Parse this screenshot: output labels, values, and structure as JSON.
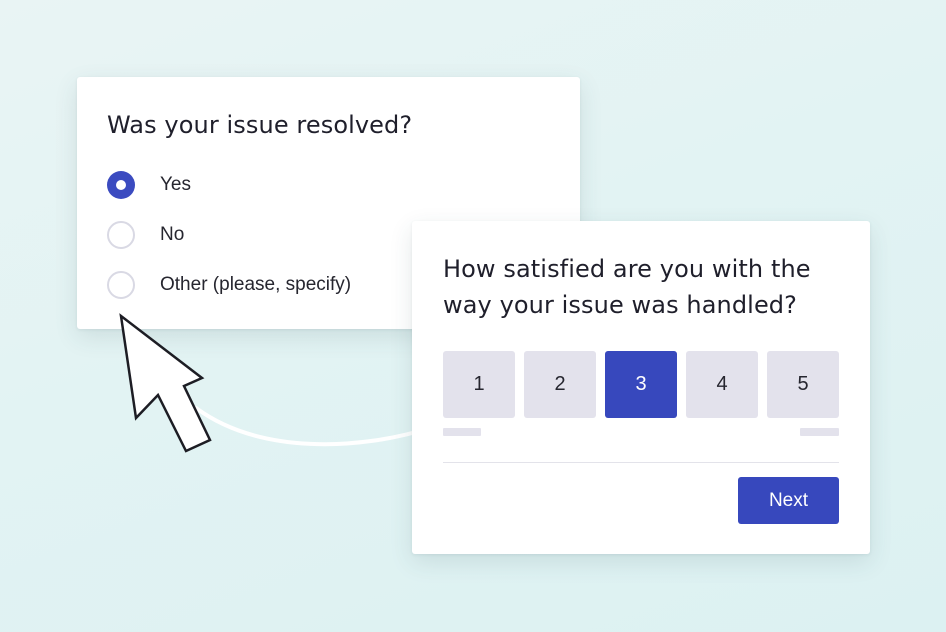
{
  "survey_resolved": {
    "question": "Was your issue resolved?",
    "options": [
      {
        "label": "Yes",
        "selected": true
      },
      {
        "label": "No",
        "selected": false
      },
      {
        "label": "Other (please, specify)",
        "selected": false
      }
    ]
  },
  "survey_satisfaction": {
    "question": "How satisfied are you with the way your issue was handled?",
    "scale": [
      "1",
      "2",
      "3",
      "4",
      "5"
    ],
    "selected_value": "3",
    "next_label": "Next"
  },
  "colors": {
    "accent": "#3748bd",
    "neutral_button": "#e3e2ec",
    "background": "#e2f3f3",
    "card": "#ffffff"
  },
  "icons": {
    "pointer": "mouse-pointer-icon"
  }
}
